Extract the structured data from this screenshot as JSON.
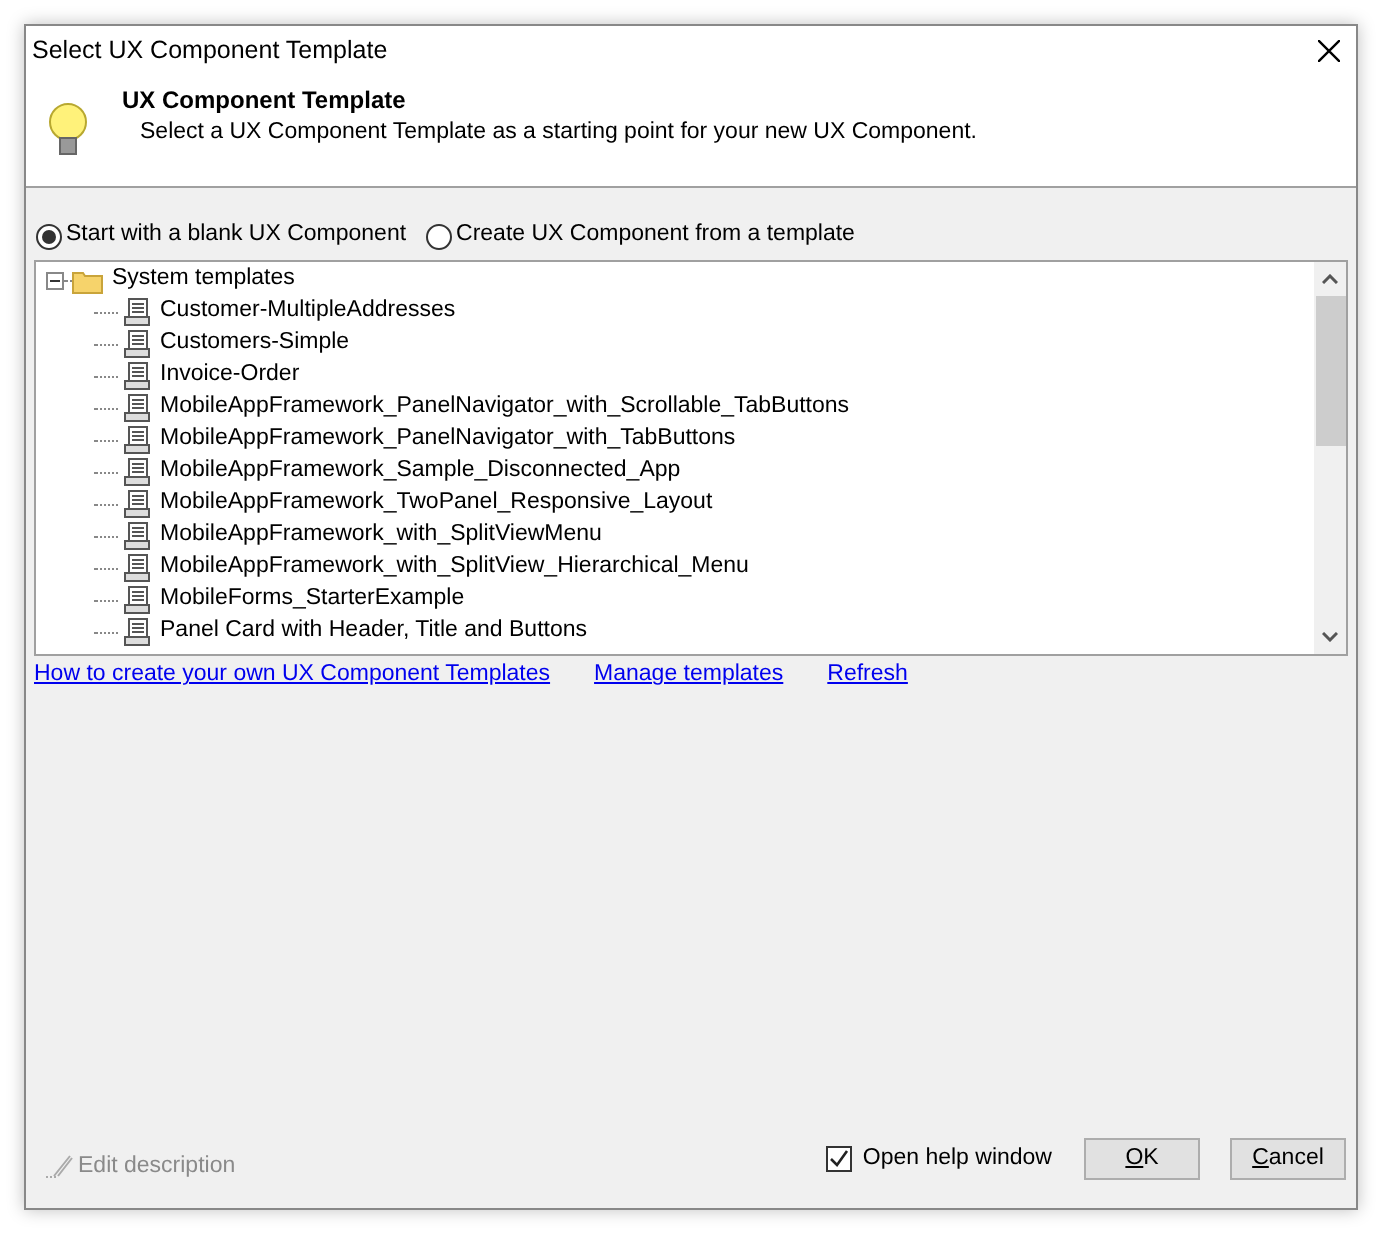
{
  "window": {
    "title": "Select UX Component Template"
  },
  "header": {
    "title": "UX Component Template",
    "subtitle": "Select a UX Component Template as a starting point for your new UX Component."
  },
  "options": [
    {
      "label": "Start with a blank UX Component",
      "selected": true
    },
    {
      "label": "Create UX Component from a template",
      "selected": false
    }
  ],
  "tree": {
    "label": "System templates",
    "expanded": true,
    "children": [
      {
        "label": "Customer-MultipleAddresses"
      },
      {
        "label": "Customers-Simple"
      },
      {
        "label": "Invoice-Order"
      },
      {
        "label": "MobileAppFramework_PanelNavigator_with_Scrollable_TabButtons"
      },
      {
        "label": "MobileAppFramework_PanelNavigator_with_TabButtons"
      },
      {
        "label": "MobileAppFramework_Sample_Disconnected_App"
      },
      {
        "label": "MobileAppFramework_TwoPanel_Responsive_Layout"
      },
      {
        "label": "MobileAppFramework_with_SplitViewMenu"
      },
      {
        "label": "MobileAppFramework_with_SplitView_Hierarchical_Menu"
      },
      {
        "label": "MobileForms_StarterExample"
      },
      {
        "label": "Panel Card with Header, Title and Buttons"
      }
    ]
  },
  "links": [
    "How to create your own UX Component Templates",
    "Manage templates",
    "Refresh"
  ],
  "edit_description": {
    "label": "Edit description",
    "disabled": true
  },
  "open_help": {
    "label": "Open help window",
    "checked": true
  },
  "buttons": [
    "OK",
    "Cancel"
  ]
}
